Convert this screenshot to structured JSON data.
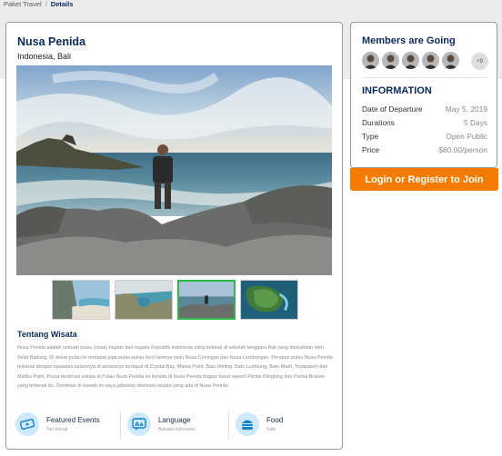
{
  "breadcrumb": {
    "parent": "Paket Travel",
    "separator": "/",
    "current": "Details"
  },
  "trip": {
    "title": "Nusa Penida",
    "location": "Indonesia, Bali"
  },
  "gallery": {
    "thumbnails": [
      "beach-cliff",
      "rock-arch",
      "coast-walker",
      "aerial-island"
    ],
    "active_index": 2
  },
  "about": {
    "title": "Tentang Wisata",
    "text": "Nusa Penida adalah sebuah pulau (nusa) bagian dari negara Republik Indonesia yang terletak di sebelah tenggara Bali yang dipisahkan oleh Selat Badung. Di dekat pulau ini terdapat juga pulau-pulau kecil lainnya yaitu Nusa Ceningan dan Nusa Lembongan. Perairan pulau Nusa Penida terkenal dengan kawasan selamnya di antaranya terdapat di Crystal Bay, Manta Point, Batu Meling, Batu Lumbung, Batu Abah, Toyapakeh dan Malibu Point. Pusat destinasi wisata di Pulau Nusa Penida ini berada di Nusa Penida bagian barat seperti Pantai Klingking dan Pantai Broken yang terkenal itu. Demikian di bawah ini saya jabarkan destinasi wisata yang ada di Nusa Penida."
  },
  "features": [
    {
      "label": "Featured Events",
      "sub": "Tari Kecak",
      "icon": "ticket-icon"
    },
    {
      "label": "Language",
      "sub": "Bahasa Indonesia",
      "icon": "language-icon"
    },
    {
      "label": "Food",
      "sub": "Sate",
      "icon": "food-icon"
    }
  ],
  "members": {
    "title": "Members are Going",
    "extra_count": "+9",
    "avatar_count": 5
  },
  "information": {
    "title": "INFORMATION",
    "rows": [
      {
        "label": "Date of Departure",
        "value": "May 5, 2019"
      },
      {
        "label": "Durations",
        "value": "5 Days"
      },
      {
        "label": "Type",
        "value": "Open Public"
      },
      {
        "label": "Price",
        "value": "$80.00/person"
      }
    ]
  },
  "cta": {
    "label": "Login or Register to Join"
  },
  "colors": {
    "navy": "#0b2a5b",
    "orange": "#f57c00",
    "active_thumb": "#2fb84a",
    "icon_bg": "#cde9fb"
  }
}
